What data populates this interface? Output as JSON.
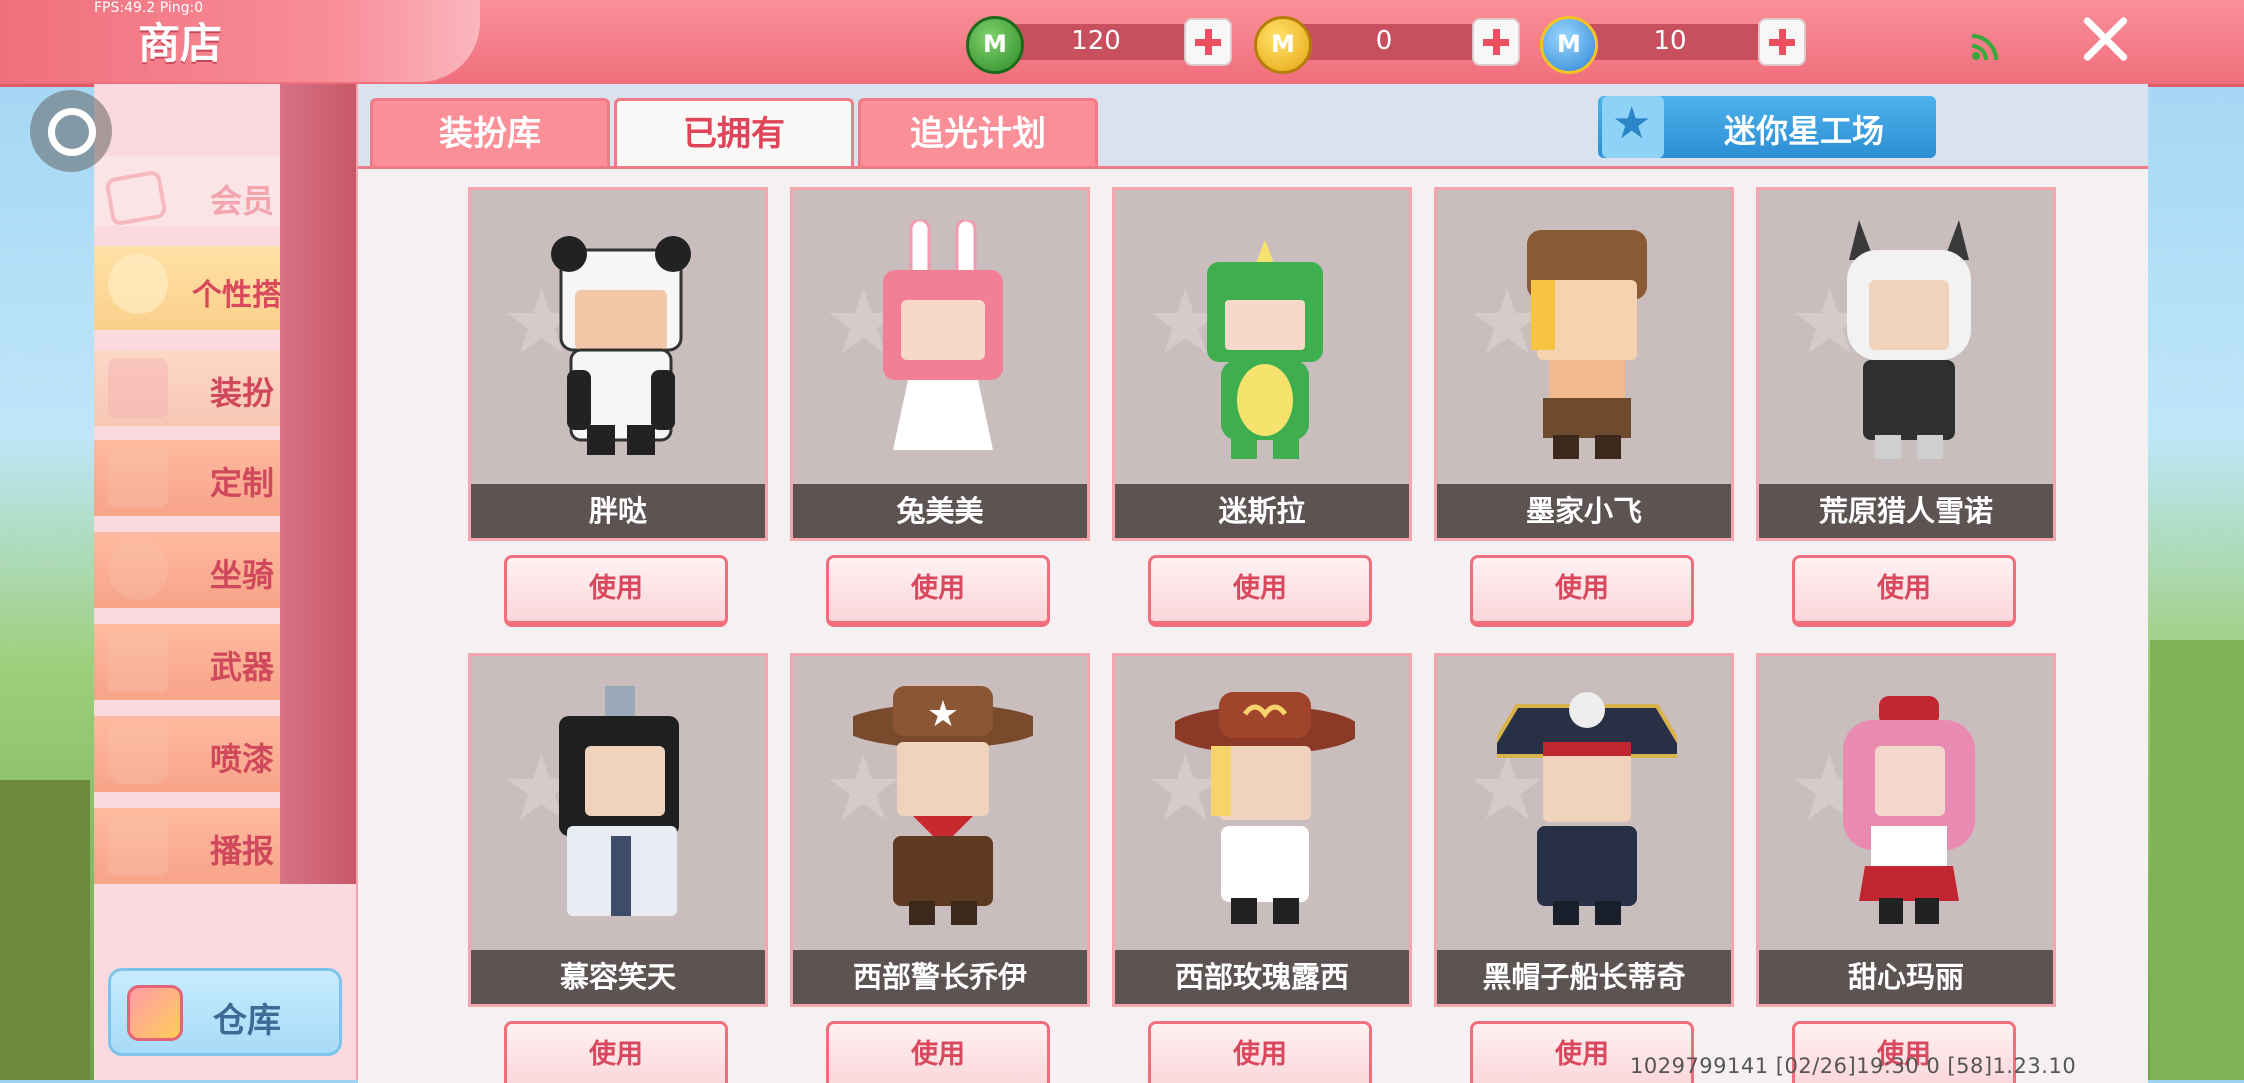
{
  "debug": "FPS:49.2 Ping:0",
  "header": {
    "title": "商店"
  },
  "currencies": [
    {
      "icon": "mini-bean-coin-icon",
      "value": "120",
      "color": "#3f9a3a",
      "symbol": "M"
    },
    {
      "icon": "mini-gold-coin-icon",
      "value": "0",
      "color": "#f2b317",
      "symbol": "M"
    },
    {
      "icon": "mini-point-coin-icon",
      "value": "10",
      "color": "#3aa0e6",
      "symbol": "M"
    }
  ],
  "sidebar": {
    "vip": "会员",
    "category": "个性搭配",
    "items": [
      {
        "label": "装扮",
        "icon": "shirt-icon"
      },
      {
        "label": "定制",
        "icon": "paint-icon"
      },
      {
        "label": "坐骑",
        "icon": "mount-icon"
      },
      {
        "label": "武器",
        "icon": "gun-icon"
      },
      {
        "label": "喷漆",
        "icon": "spray-can-icon"
      },
      {
        "label": "播报",
        "icon": "broadcast-icon"
      }
    ],
    "warehouse": "仓库"
  },
  "tabs": [
    "装扮库",
    "已拥有",
    "追光计划"
  ],
  "active_tab": "已拥有",
  "studio_button": "迷你星工场",
  "skins_row1": [
    {
      "name": "胖哒",
      "color": "#f5f5f5",
      "accent": "#222222"
    },
    {
      "name": "兔美美",
      "color": "#f27f95",
      "accent": "#ffffff"
    },
    {
      "name": "迷斯拉",
      "color": "#3fae4f",
      "accent": "#f5e36d"
    },
    {
      "name": "墨家小飞",
      "color": "#8a5a34",
      "accent": "#f6c442"
    },
    {
      "name": "荒原猎人雪诺",
      "color": "#3a3a3a",
      "accent": "#ffffff"
    }
  ],
  "skins_row2": [
    {
      "name": "慕容笑天",
      "color": "#e8ecf3",
      "accent": "#1f1f1f"
    },
    {
      "name": "西部警长乔伊",
      "color": "#7a4a2c",
      "accent": "#c9282e"
    },
    {
      "name": "西部玫瑰露西",
      "color": "#8a3a26",
      "accent": "#f6d36b"
    },
    {
      "name": "黑帽子船长蒂奇",
      "color": "#283045",
      "accent": "#d9b24a"
    },
    {
      "name": "甜心玛丽",
      "color": "#e98bb0",
      "accent": "#c22630"
    }
  ],
  "use_label": "使用",
  "footer": "1029799141    [02/26]19:30 0  [58]1.23.10"
}
